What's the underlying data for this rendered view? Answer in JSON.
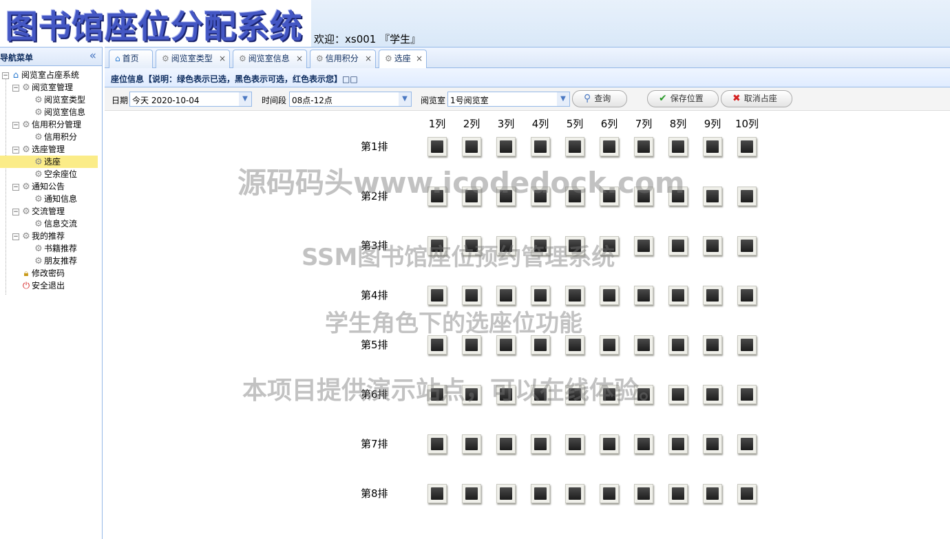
{
  "header": {
    "logo": "图书馆座位分配系统",
    "welcome": "欢迎：xs001 『学生』"
  },
  "sidebar": {
    "title": "导航菜单",
    "collapse_icon": "«",
    "root": "阅览室占座系统",
    "groups": [
      {
        "label": "阅览室管理",
        "children": [
          "阅览室类型",
          "阅览室信息"
        ]
      },
      {
        "label": "信用积分管理",
        "children": [
          "信用积分"
        ]
      },
      {
        "label": "选座管理",
        "children": [
          "选座",
          "空余座位"
        ]
      },
      {
        "label": "通知公告",
        "children": [
          "通知信息"
        ]
      },
      {
        "label": "交流管理",
        "children": [
          "信息交流"
        ]
      },
      {
        "label": "我的推荐",
        "children": [
          "书籍推荐",
          "朋友推荐"
        ]
      }
    ],
    "change_password": "修改密码",
    "logout": "安全退出",
    "selected": "选座"
  },
  "tabs": [
    {
      "label": "首页",
      "icon": "home-icon",
      "closable": false
    },
    {
      "label": "阅览室类型",
      "icon": "gear-icon",
      "closable": true
    },
    {
      "label": "阅览室信息",
      "icon": "gear-icon",
      "closable": true
    },
    {
      "label": "信用积分",
      "icon": "gear-icon",
      "closable": true
    },
    {
      "label": "选座",
      "icon": "gear-icon",
      "closable": true,
      "active": true
    }
  ],
  "panel": {
    "title": "座位信息【说明：绿色表示已选，黑色表示可选，红色表示您】□□"
  },
  "toolbar": {
    "date_label": "日期",
    "date_value": "今天  2020-10-04",
    "time_label": "时间段",
    "time_value": "08点-12点",
    "room_label": "阅览室",
    "room_value": "1号阅览室",
    "query_label": "查询",
    "save_label": "保存位置",
    "cancel_label": "取消占座"
  },
  "seat_grid": {
    "columns": [
      "1列",
      "2列",
      "3列",
      "4列",
      "5列",
      "6列",
      "7列",
      "8列",
      "9列",
      "10列"
    ],
    "rows": [
      "第1排",
      "第2排",
      "第3排",
      "第4排",
      "第5排",
      "第6排",
      "第7排",
      "第8排"
    ],
    "seat_state": "available"
  },
  "colors": {
    "accent": "#95b8e7",
    "selected_nav": "#fbec88",
    "seat_available": "#2a2a2a"
  }
}
